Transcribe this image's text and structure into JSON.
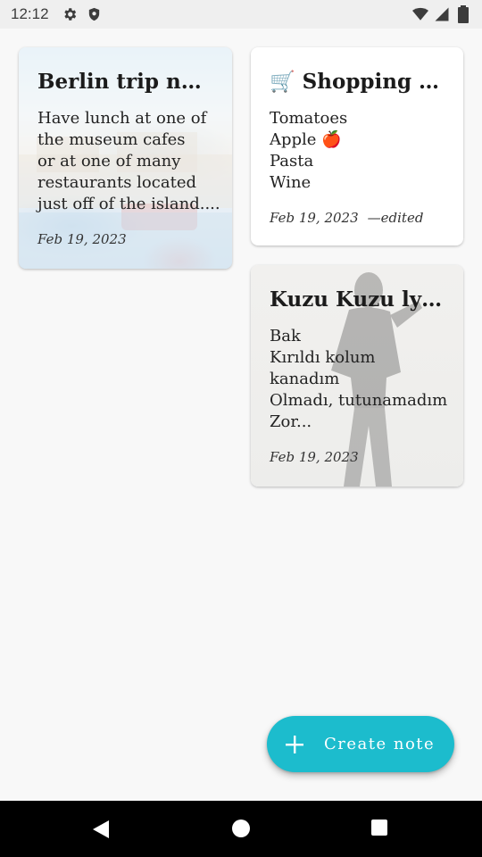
{
  "status_bar": {
    "time": "12:12",
    "icons": [
      "gear-icon",
      "shield-icon",
      "wifi-icon",
      "signal-icon",
      "battery-icon"
    ]
  },
  "notes": [
    {
      "title": "Berlin trip notes",
      "body": [
        "Have lunch at one of",
        "the museum cafes",
        "or at one of many",
        "restaurants located",
        "just off of the island...."
      ],
      "date": "Feb 19, 2023",
      "edited": ""
    },
    {
      "title_icon": "🛒",
      "title": "Shopping list",
      "body": [
        "Tomatoes",
        "Apple 🍎",
        "Pasta",
        "Wine"
      ],
      "date": "Feb 19, 2023",
      "edited": "—edited"
    },
    {
      "title": "Kuzu Kuzu lyr...",
      "body": [
        "Bak",
        "Kırıldı kolum",
        "kanadım",
        "Olmadı, tutunamadım",
        "Zor..."
      ],
      "date": "Feb 19, 2023",
      "edited": ""
    }
  ],
  "fab": {
    "label": "Create note",
    "icon": "plus-icon",
    "color": "#1cbccd"
  },
  "nav_bar": {
    "icons": [
      "back-icon",
      "home-icon",
      "recents-icon"
    ]
  }
}
